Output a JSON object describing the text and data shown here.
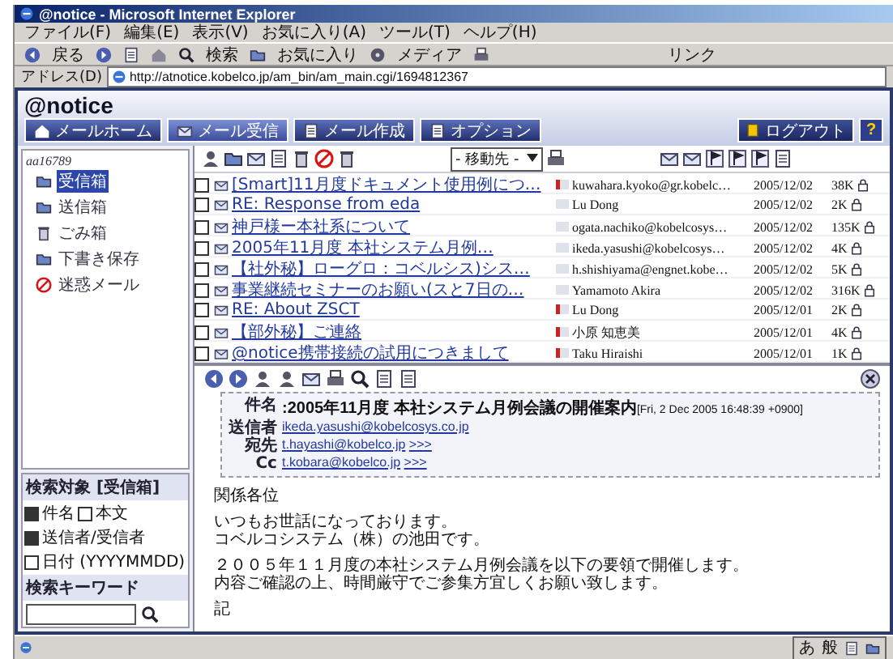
{
  "window": {
    "title": "@notice - Microsoft Internet Explorer"
  },
  "menu": [
    "ファイル(F)",
    "編集(E)",
    "表示(V)",
    "お気に入り(A)",
    "ツール(T)",
    "ヘルプ(H)"
  ],
  "toolbar": {
    "back": "戻る",
    "search": "検索",
    "favorites": "お気に入り",
    "media": "メディア",
    "links": "リンク"
  },
  "address_bar": {
    "label": "アドレス(D)",
    "url": "http://atnotice.kobelco.jp/am_bin/am_main.cgi/1694812367"
  },
  "app": {
    "logo": "@notice",
    "nav": [
      {
        "label": "メールホーム",
        "selected": false
      },
      {
        "label": "メール受信",
        "selected": true
      },
      {
        "label": "メール作成",
        "selected": false
      },
      {
        "label": "オプション",
        "selected": false
      }
    ],
    "logout": "ログアウト",
    "help": "?"
  },
  "sidebar": {
    "user": "aa16789",
    "folders": [
      {
        "label": "受信箱",
        "selected": true
      },
      {
        "label": "送信箱",
        "selected": false
      },
      {
        "label": "ごみ箱",
        "selected": false
      },
      {
        "label": "下書き保存",
        "selected": false
      },
      {
        "label": "迷惑メール",
        "selected": false
      }
    ],
    "search": {
      "title": "検索対象 [受信箱]",
      "options": [
        {
          "label": "件名",
          "checked": true
        },
        {
          "label": "本文",
          "checked": false
        },
        {
          "label": "送信者/受信者",
          "checked": true
        },
        {
          "label": "日付 (YYYYMMDD)",
          "checked": false
        }
      ],
      "keyword_label": "検索キーワード"
    }
  },
  "message_list": {
    "move_to": "- 移動先 -",
    "rows": [
      {
        "subject": "[Smart]11月度ドキュメント使用例につ…",
        "from": "kuwahara.kyoko@gr.kobelc…",
        "date": "2005/12/02",
        "size": "38K",
        "checked": false,
        "marked": true
      },
      {
        "subject": "RE: Response from eda",
        "from": "Lu Dong",
        "date": "2005/12/02",
        "size": "2K",
        "checked": false,
        "marked": false
      },
      {
        "subject": "神戸様ー本社系について",
        "from": "ogata.nachiko@kobelcosys…",
        "date": "2005/12/02",
        "size": "135K",
        "checked": false,
        "marked": false
      },
      {
        "subject": "2005年11月度 本社システム月例…",
        "from": "ikeda.yasushi@kobelcosys…",
        "date": "2005/12/02",
        "size": "4K",
        "checked": false,
        "marked": false
      },
      {
        "subject": "【社外秘】ローグロ：コベルシス)シス…",
        "from": "h.shishiyama@engnet.kobe…",
        "date": "2005/12/02",
        "size": "5K",
        "checked": false,
        "marked": false
      },
      {
        "subject": "事業継続セミナーのお願い(スと7日の…",
        "from": "Yamamoto Akira",
        "date": "2005/12/02",
        "size": "316K",
        "checked": false,
        "marked": false
      },
      {
        "subject": "RE: About ZSCT",
        "from": "Lu Dong",
        "date": "2005/12/01",
        "size": "2K",
        "checked": false,
        "marked": true
      },
      {
        "subject": "【部外秘】ご連絡",
        "from": "小原 知恵美",
        "date": "2005/12/01",
        "size": "4K",
        "checked": false,
        "marked": true
      },
      {
        "subject": "@notice携帯接続の試用につきまして",
        "from": "Taku Hiraishi",
        "date": "2005/12/01",
        "size": "1K",
        "checked": false,
        "marked": true
      }
    ]
  },
  "preview": {
    "header": [
      {
        "label": "件名",
        "value": ":2005年11月度 本社システム月例会議の開催案内[Fri, 2 Dec 2005 16:48:39 +0900]",
        "kind": "subject"
      },
      {
        "label": "送信者",
        "value": "ikeda.yasushi@kobelcosys.co.jp",
        "kind": "link"
      },
      {
        "label": "宛先",
        "value": "t.hayashi@kobelco.jp",
        "more": ">>>",
        "kind": "link"
      },
      {
        "label": "Cc",
        "value": "t.kobara@kobelco.jp",
        "more": ">>>",
        "kind": "link"
      }
    ],
    "body": [
      [
        "関係各位"
      ],
      [
        "いつもお世話になっております。",
        "コベルコシステム（株）の池田です。"
      ],
      [
        "２００５年１１月度の本社システム月例会議を以下の要領で開催します。",
        "内容ご確認の上、時間厳守でご参集方宜しくお願い致します。"
      ],
      [
        "記"
      ]
    ]
  },
  "language_bar": {
    "mode": "あ",
    "conversion": "般"
  }
}
